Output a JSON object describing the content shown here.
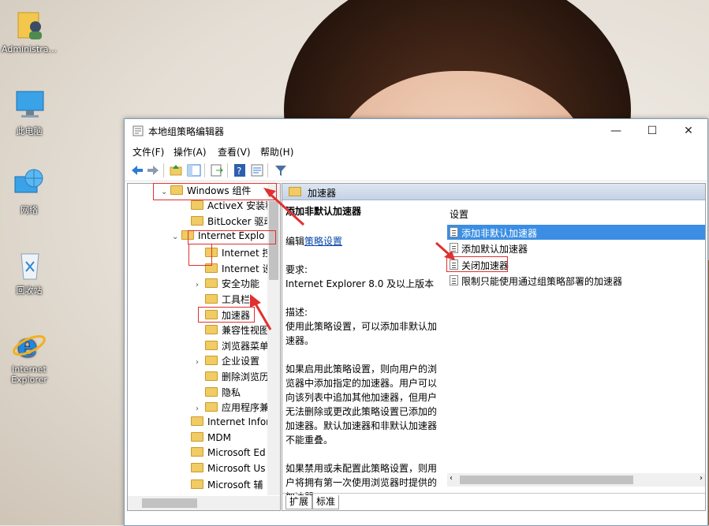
{
  "desktop": {
    "icons": [
      {
        "label": "Administra..."
      },
      {
        "label": "此电脑"
      },
      {
        "label": "网络"
      },
      {
        "label": "回收站"
      },
      {
        "label": "Internet Explorer"
      }
    ]
  },
  "window": {
    "title": "本地组策略编辑器",
    "controls": {
      "minimize": "—",
      "maximize": "☐",
      "close": "✕"
    },
    "menu": [
      "文件(F)",
      "操作(A)",
      "查看(V)",
      "帮助(H)"
    ]
  },
  "tree": {
    "items": [
      {
        "label": "Windows 组件",
        "expander": "⌄",
        "caret": "^"
      },
      {
        "label": "ActiveX 安装程"
      },
      {
        "label": "BitLocker 驱动"
      },
      {
        "label": "Internet Explo",
        "expander": "⌄"
      },
      {
        "label": "Internet 控"
      },
      {
        "label": "Internet 设"
      },
      {
        "label": "安全功能",
        "expander": "›"
      },
      {
        "label": "工具栏"
      },
      {
        "label": "加速器"
      },
      {
        "label": "兼容性视图"
      },
      {
        "label": "浏览器菜单"
      },
      {
        "label": "企业设置",
        "expander": "›"
      },
      {
        "label": "删除浏览历"
      },
      {
        "label": "隐私"
      },
      {
        "label": "应用程序兼",
        "expander": "›"
      },
      {
        "label": "Internet Infor"
      },
      {
        "label": "MDM"
      },
      {
        "label": "Microsoft Ed"
      },
      {
        "label": "Microsoft Us"
      },
      {
        "label": "Microsoft 辅"
      }
    ]
  },
  "right": {
    "header": "加速器",
    "desc": {
      "name": "添加非默认加速器",
      "edit_prefix": "编辑",
      "edit_link": "策略设置",
      "req_label": "要求:",
      "req_value": "Internet Explorer 8.0 及以上版本",
      "desc_label": "描述:",
      "desc_1": "使用此策略设置，可以添加非默认加速器。",
      "desc_2": "如果启用此策略设置，则向用户的浏览器中添加指定的加速器。用户可以向该列表中追加其他加速器，但用户无法删除或更改此策略设置已添加的加速器。默认加速器和非默认加速器不能重叠。",
      "desc_3": "如果禁用或未配置此策略设置，则用户将拥有第一次使用浏览器时提供的加速器。"
    },
    "settings_header": "设置",
    "settings": [
      {
        "label": "添加非默认加速器"
      },
      {
        "label": "添加默认加速器"
      },
      {
        "label": "关闭加速器"
      },
      {
        "label": "限制只能使用通过组策略部署的加速器"
      }
    ],
    "tabs": [
      "扩展",
      "标准"
    ]
  }
}
